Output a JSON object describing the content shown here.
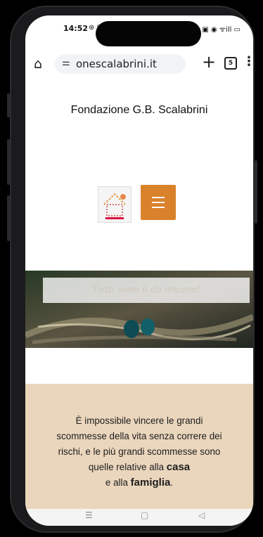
{
  "status": {
    "time": "14:52",
    "left_icons": "⊛ ▣",
    "right_icons": "▣ ◉ ᯤill ▭"
  },
  "browser": {
    "url": "onescalabrini.it",
    "tab_count": "5",
    "home_icon": "home-icon",
    "tune_icon": "tune-icon"
  },
  "page": {
    "title": "Fondazione G.B. Scalabrini",
    "hero_caption": "Tutti sono il da ancora!",
    "quote_line1": "È impossibile vincere le grandi",
    "quote_line2": "scommesse della vita senza correre dei",
    "quote_line3": "rischi, e le più grandi scommesse sono",
    "quote_line4_a": "quelle relative alla ",
    "quote_bold_1": "casa",
    "quote_line5_a": "e alla ",
    "quote_bold_2": "famiglia",
    "quote_end": "."
  },
  "navbar": {
    "menu": "☰",
    "home": "▢",
    "back": "◁"
  },
  "colors": {
    "accent": "#d9822b",
    "quote_bg": "#ead6bd",
    "phone_frame": "#1b1b1d"
  }
}
